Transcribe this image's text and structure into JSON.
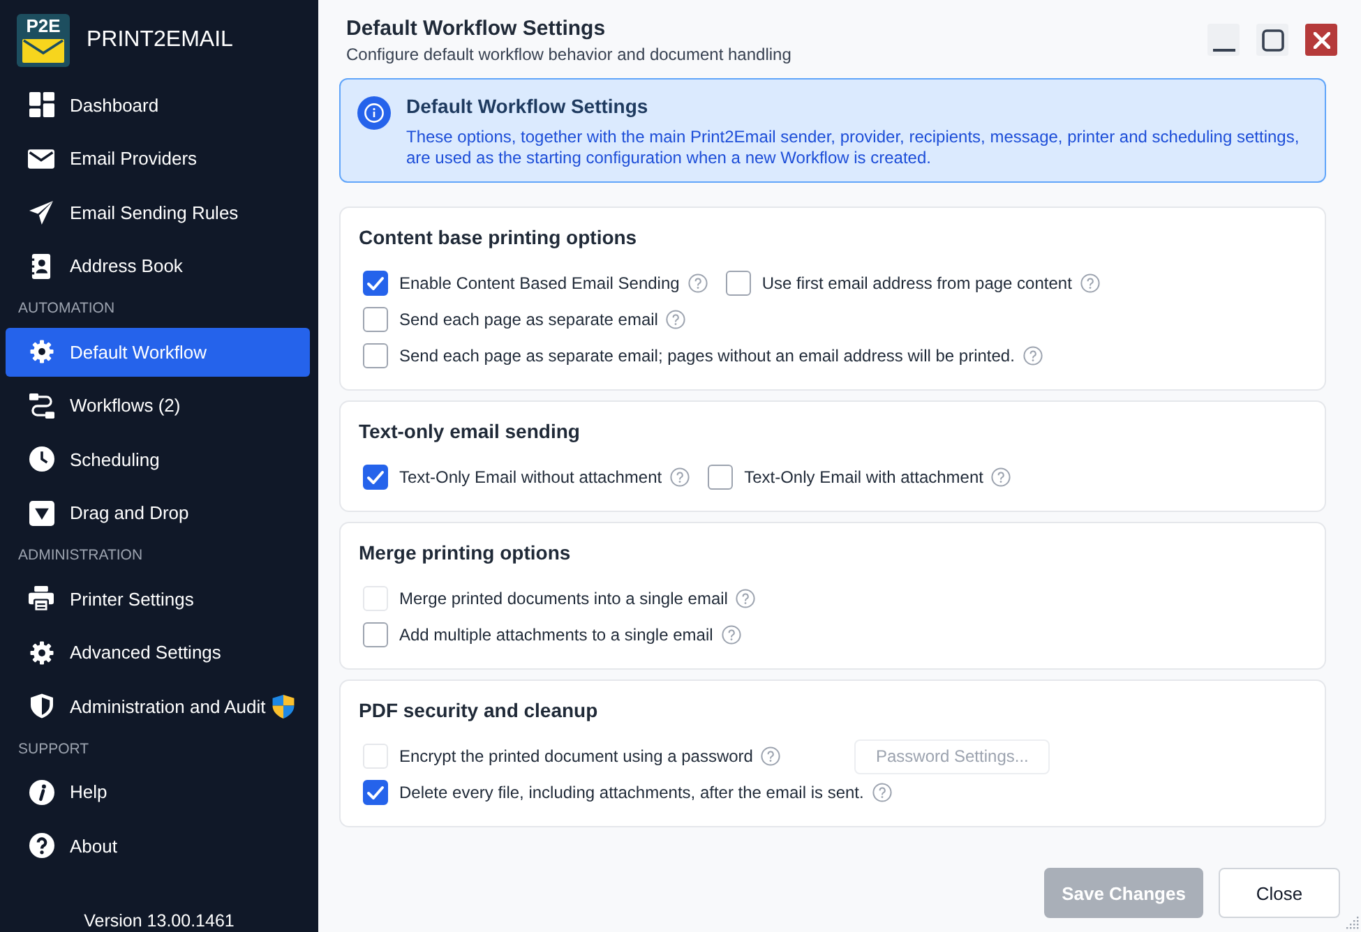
{
  "sidebar": {
    "logo_text": "P2E",
    "app_name": "PRINT2EMAIL",
    "items": [
      {
        "kind": "item",
        "label": "Dashboard",
        "selected": false,
        "elevated": false
      },
      {
        "kind": "item",
        "label": "Email Providers",
        "selected": false,
        "elevated": false
      },
      {
        "kind": "item",
        "label": "Email Sending Rules",
        "selected": false,
        "elevated": false
      },
      {
        "kind": "item",
        "label": "Address Book",
        "selected": false,
        "elevated": false
      },
      {
        "kind": "section",
        "label": "AUTOMATION"
      },
      {
        "kind": "item",
        "label": "Default Workflow",
        "selected": true,
        "elevated": false
      },
      {
        "kind": "item",
        "label": "Workflows (2)",
        "selected": false,
        "elevated": false
      },
      {
        "kind": "item",
        "label": "Scheduling",
        "selected": false,
        "elevated": false
      },
      {
        "kind": "item",
        "label": "Drag and Drop",
        "selected": false,
        "elevated": false
      },
      {
        "kind": "section",
        "label": "ADMINISTRATION"
      },
      {
        "kind": "item",
        "label": "Printer Settings",
        "selected": false,
        "elevated": false
      },
      {
        "kind": "item",
        "label": "Advanced Settings",
        "selected": false,
        "elevated": false
      },
      {
        "kind": "item",
        "label": "Administration and Audit",
        "selected": false,
        "elevated": true
      },
      {
        "kind": "section",
        "label": "SUPPORT"
      },
      {
        "kind": "item",
        "label": "Help",
        "selected": false,
        "elevated": false
      },
      {
        "kind": "item",
        "label": "About",
        "selected": false,
        "elevated": false
      }
    ],
    "version": "Version 13.00.1461"
  },
  "header": {
    "title": "Default Workflow Settings",
    "subtitle": "Configure default workflow behavior and document handling"
  },
  "info": {
    "title": "Default Workflow Settings",
    "text": "These options, together with the main Print2Email sender, provider, recipients, message, printer and scheduling settings, are used as the starting configuration when a new Workflow is created."
  },
  "sections": [
    {
      "title": "Content base printing options",
      "rows": [
        {
          "items": [
            {
              "kind": "checkbox",
              "label": "Enable Content Based Email Sending",
              "checked": true,
              "disabled": false,
              "help": true
            },
            {
              "kind": "checkbox",
              "label": "Use first email address from page content",
              "checked": false,
              "disabled": false,
              "help": true
            }
          ]
        },
        {
          "items": [
            {
              "kind": "checkbox",
              "label": "Send each page as separate email",
              "checked": false,
              "disabled": false,
              "help": true
            }
          ]
        },
        {
          "items": [
            {
              "kind": "checkbox",
              "label": "Send each page as separate email; pages without an email address will be printed.",
              "checked": false,
              "disabled": false,
              "help": true
            }
          ]
        }
      ]
    },
    {
      "title": "Text-only email sending",
      "rows": [
        {
          "items": [
            {
              "kind": "checkbox",
              "label": "Text-Only Email without attachment",
              "checked": true,
              "disabled": false,
              "help": true
            },
            {
              "kind": "checkbox",
              "label": "Text-Only Email with attachment",
              "checked": false,
              "disabled": false,
              "help": true
            }
          ]
        }
      ]
    },
    {
      "title": "Merge printing options",
      "rows": [
        {
          "items": [
            {
              "kind": "checkbox",
              "label": "Merge printed documents into a single email",
              "checked": false,
              "disabled": true,
              "help": true
            }
          ]
        },
        {
          "items": [
            {
              "kind": "checkbox",
              "label": "Add multiple attachments to a single email",
              "checked": false,
              "disabled": false,
              "help": true
            }
          ]
        }
      ]
    },
    {
      "title": "PDF security and cleanup",
      "rows": [
        {
          "items": [
            {
              "kind": "checkbox",
              "label": "Encrypt the printed document using a password",
              "checked": false,
              "disabled": true,
              "help": true
            },
            {
              "kind": "button",
              "label": "Password Settings...",
              "disabled": true
            }
          ]
        },
        {
          "items": [
            {
              "kind": "checkbox",
              "label": "Delete every file, including attachments, after the email is sent.",
              "checked": true,
              "disabled": false,
              "help": true
            }
          ]
        }
      ]
    }
  ],
  "footer": {
    "buttons": [
      {
        "kind": "primary",
        "label": "Save Changes",
        "disabled": true
      },
      {
        "kind": "secondary",
        "label": "Close",
        "disabled": false
      }
    ]
  }
}
